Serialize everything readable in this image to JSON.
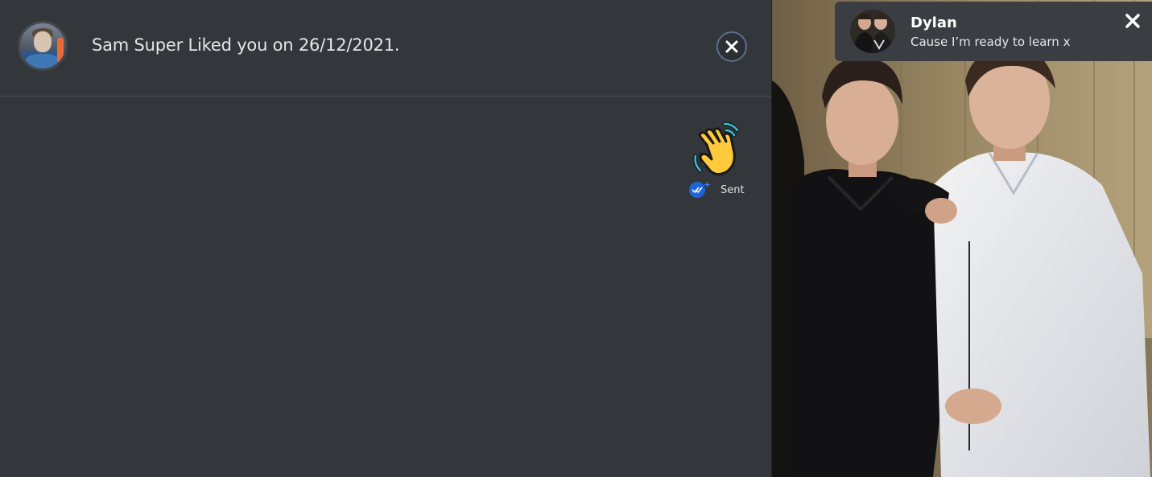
{
  "header": {
    "liked_text": "Sam Super Liked you on 26/12/2021."
  },
  "message": {
    "emoji": "👋",
    "status": "Sent"
  },
  "notification": {
    "name": "Dylan",
    "text": "Cause I’m ready to learn x"
  },
  "colors": {
    "background": "#33363a",
    "read_badge": "#1e64d8",
    "close_ring": "#5a6e8c"
  },
  "icons": {
    "close": "close-icon",
    "read": "double-check-icon",
    "sparkle": "sparkle-icon",
    "notif_close": "close-icon"
  }
}
